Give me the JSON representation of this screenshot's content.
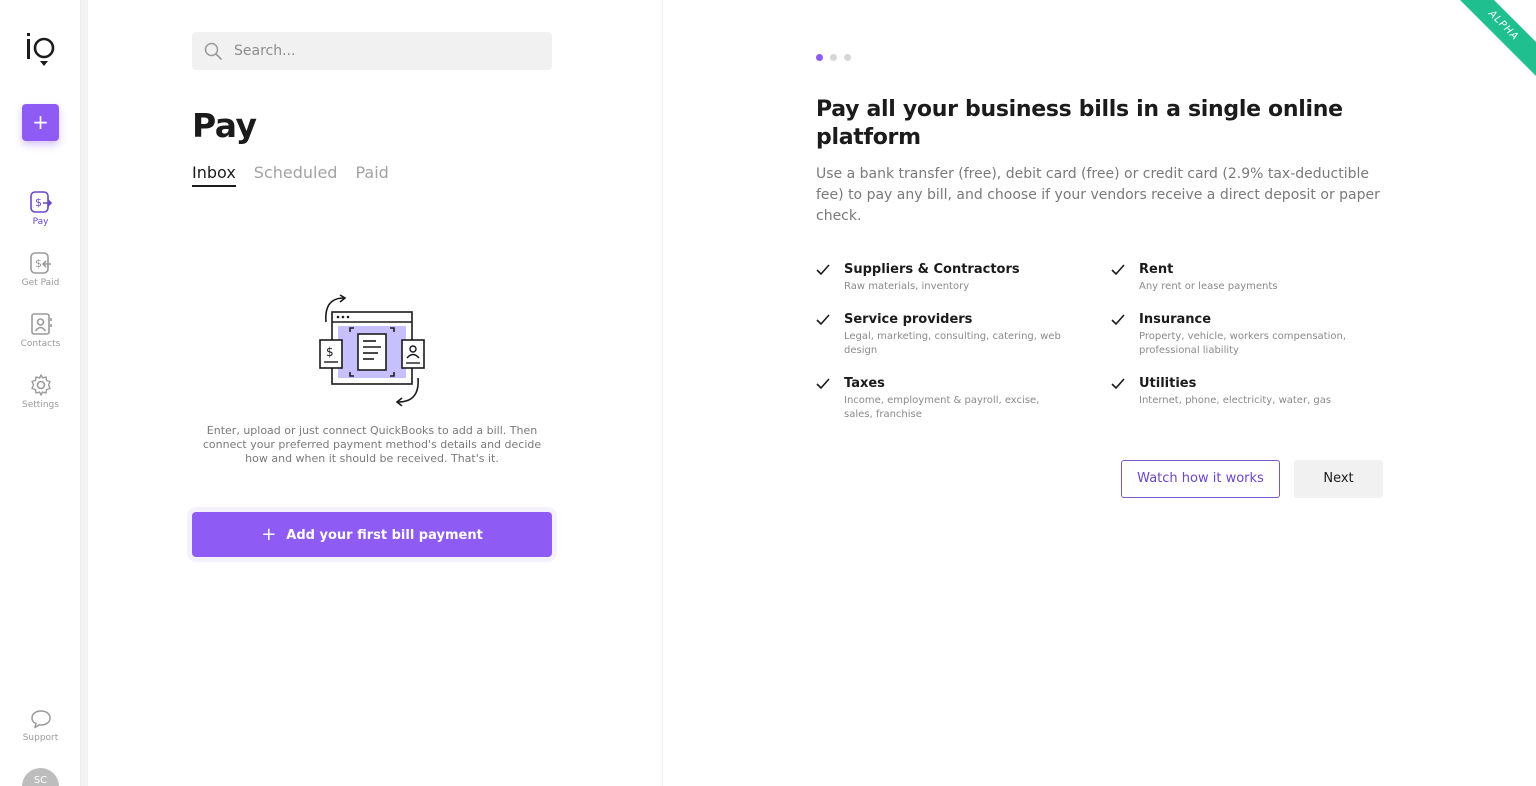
{
  "sidebar": {
    "new_label": "+",
    "items": [
      {
        "label": "Pay"
      },
      {
        "label": "Get Paid"
      },
      {
        "label": "Contacts"
      },
      {
        "label": "Settings"
      }
    ],
    "support_label": "Support",
    "avatar_initials": "SC"
  },
  "left": {
    "search_placeholder": "Search...",
    "title": "Pay",
    "tabs": [
      {
        "label": "Inbox"
      },
      {
        "label": "Scheduled"
      },
      {
        "label": "Paid"
      }
    ],
    "empty_text": "Enter, upload or just connect QuickBooks to add a bill. Then connect your preferred payment method's details and decide how and when it should be received. That's it.",
    "add_button_label": "Add your first bill payment"
  },
  "right": {
    "title": "Pay all your business bills in a single online platform",
    "description": "Use a bank transfer (free), debit card (free) or credit card (2.9% tax-deductible fee) to pay any bill, and choose if your vendors receive a direct deposit or paper check.",
    "features": [
      {
        "title": "Suppliers & Contractors",
        "desc": "Raw materials, inventory"
      },
      {
        "title": "Rent",
        "desc": "Any rent or lease payments"
      },
      {
        "title": "Service providers",
        "desc": "Legal, marketing, consulting, catering, web design"
      },
      {
        "title": "Insurance",
        "desc": "Property, vehicle, workers compensation, professional liability"
      },
      {
        "title": "Taxes",
        "desc": "Income, employment & payroll, excise, sales, franchise"
      },
      {
        "title": "Utilities",
        "desc": "Internet, phone, electricity, water, gas"
      }
    ],
    "watch_label": "Watch how it works",
    "next_label": "Next"
  },
  "ribbon_label": "ALPHA",
  "colors": {
    "accent": "#8e5cf4",
    "ribbon": "#1fbf8f"
  }
}
